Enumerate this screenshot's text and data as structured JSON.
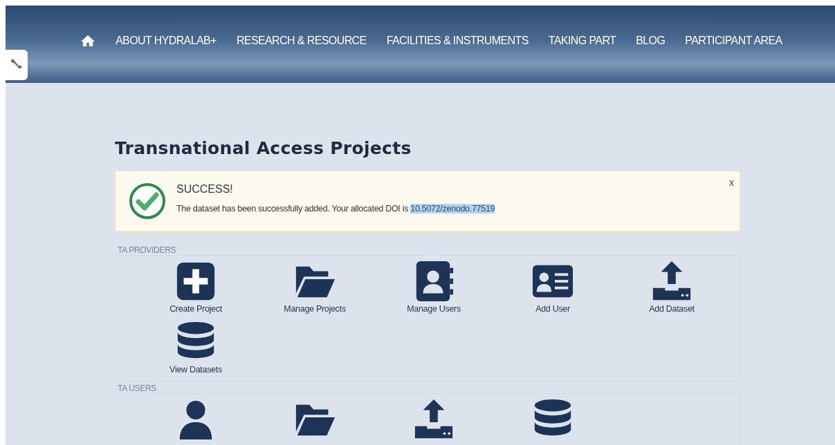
{
  "nav": {
    "items": [
      {
        "label": "ABOUT HYDRALAB+"
      },
      {
        "label": "RESEARCH & RESOURCE"
      },
      {
        "label": "FACILITIES & INSTRUMENTS"
      },
      {
        "label": "TAKING PART"
      },
      {
        "label": "BLOG"
      },
      {
        "label": "PARTICIPANT AREA"
      }
    ]
  },
  "page_title": "Transnational Access Projects",
  "alert": {
    "title": "SUCCESS!",
    "message": "The dataset has been successfully added. Your allocated DOI is ",
    "doi": {
      "text": "10.5072/zenodo.77519",
      "selected": true
    },
    "close": "x"
  },
  "sections": [
    {
      "title": "TA PROVIDERS",
      "items": [
        {
          "kind": "plus",
          "label": "Create Project"
        },
        {
          "kind": "folder",
          "label": "Manage Projects"
        },
        {
          "kind": "contacts",
          "label": "Manage Users"
        },
        {
          "kind": "idcard",
          "label": "Add User"
        },
        {
          "kind": "upload",
          "label": "Add Dataset"
        },
        {
          "kind": "database",
          "label": "View Datasets"
        }
      ]
    },
    {
      "title": "TA USERS",
      "items": [
        {
          "kind": "user"
        },
        {
          "kind": "folder"
        },
        {
          "kind": "upload"
        },
        {
          "kind": "database"
        }
      ]
    }
  ]
}
